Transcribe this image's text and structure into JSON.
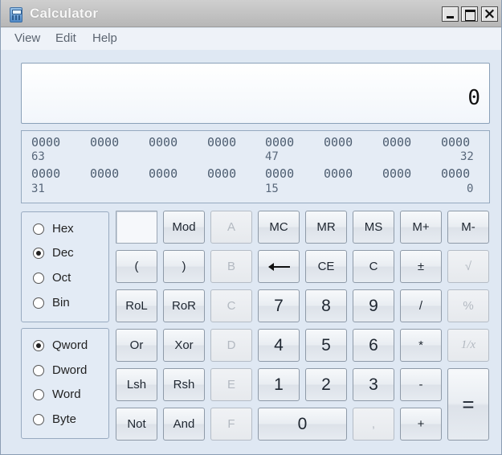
{
  "window": {
    "title": "Calculator"
  },
  "caption": {
    "close_glyph": "×"
  },
  "menu": {
    "items": [
      "View",
      "Edit",
      "Help"
    ]
  },
  "display": {
    "value": "0"
  },
  "bits": {
    "row1": {
      "nibbles": [
        "0000",
        "0000",
        "0000",
        "0000",
        "0000",
        "0000",
        "0000",
        "0000"
      ],
      "left_pos": "63",
      "mid_pos": "47",
      "right_pos": "32"
    },
    "row2": {
      "nibbles": [
        "0000",
        "0000",
        "0000",
        "0000",
        "0000",
        "0000",
        "0000",
        "0000"
      ],
      "left_pos": "31",
      "mid_pos": "15",
      "right_pos": "0"
    }
  },
  "base_options": {
    "selected": "Dec",
    "items": [
      "Hex",
      "Dec",
      "Oct",
      "Bin"
    ]
  },
  "word_options": {
    "selected": "Qword",
    "items": [
      "Qword",
      "Dword",
      "Word",
      "Byte"
    ]
  },
  "keys": {
    "mod": "Mod",
    "a": "A",
    "mc": "MC",
    "mr": "MR",
    "ms": "MS",
    "mplus": "M+",
    "mminus": "M-",
    "lparen": "(",
    "rparen": ")",
    "b": "B",
    "ce": "CE",
    "c": "C",
    "plusminus": "±",
    "sqrt": "√",
    "rol": "RoL",
    "ror": "RoR",
    "hex_c": "C",
    "seven": "7",
    "eight": "8",
    "nine": "9",
    "divide": "/",
    "percent": "%",
    "or": "Or",
    "xor": "Xor",
    "d": "D",
    "four": "4",
    "five": "5",
    "six": "6",
    "multiply": "*",
    "reciprocal": "1/x",
    "lsh": "Lsh",
    "rsh": "Rsh",
    "e": "E",
    "one": "1",
    "two": "2",
    "three": "3",
    "minus": "-",
    "equals": "=",
    "not": "Not",
    "and": "And",
    "f": "F",
    "zero": "0",
    "decimal": ",",
    "plus": "+"
  }
}
